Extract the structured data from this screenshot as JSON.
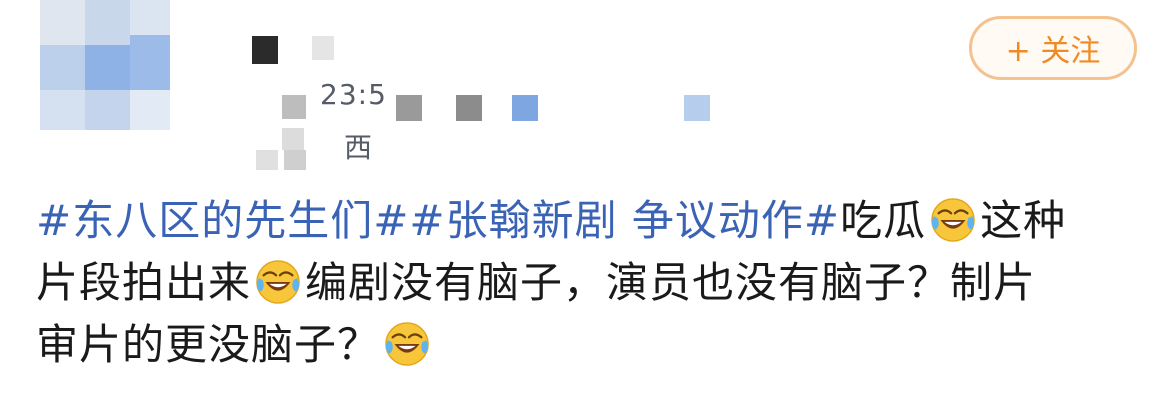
{
  "header": {
    "time_fragment": "23:5",
    "location_fragment": "西",
    "follow_label": "+ 关注"
  },
  "post": {
    "lines": [
      [
        {
          "kind": "tag",
          "text": "#东八区的先生们#"
        },
        {
          "kind": "tag",
          "text": "#张翰新剧 争议动作#"
        },
        {
          "kind": "text",
          "text": "吃瓜"
        },
        {
          "kind": "emoji",
          "name": "laughing-crying-face"
        },
        {
          "kind": "text",
          "text": "这种"
        }
      ],
      [
        {
          "kind": "text",
          "text": "片段拍出来"
        },
        {
          "kind": "emoji",
          "name": "laughing-crying-face"
        },
        {
          "kind": "text",
          "text": "编剧没有脑子，演员也没有脑子？制片"
        }
      ],
      [
        {
          "kind": "text",
          "text": "审片的更没脑子？"
        },
        {
          "kind": "emoji",
          "name": "laughing-crying-face"
        }
      ]
    ]
  },
  "colors": {
    "hashtag": "#3b63b5",
    "text": "#1a1a1a",
    "follow_accent": "#f08a24",
    "follow_border": "#f4c28f"
  }
}
